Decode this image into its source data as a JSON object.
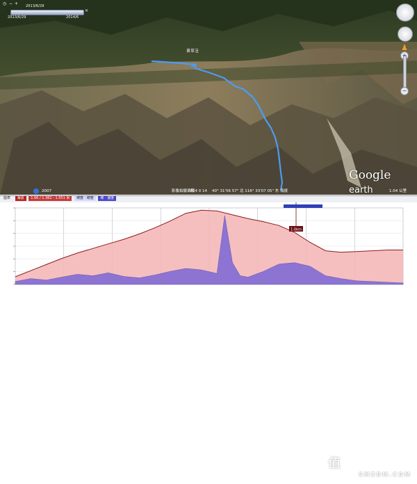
{
  "app": "Google Earth",
  "timeline": {
    "start_date": "2013/6/29",
    "end_date": "2014/6",
    "progress": 1.0
  },
  "map": {
    "place_label": "黄草洼",
    "logo_google": "Google",
    "logo_earth": "earth"
  },
  "statusbar": {
    "year": "2007",
    "imagery_date_label": "影像拍摄日期",
    "imagery_date": "2014 0 14",
    "coords": "40° 31'56 57\" 北 116° 33'07 05\" 东 海拔",
    "elev": "1.04 公里"
  },
  "profile": {
    "legend": [
      "图表",
      "海拔",
      "1.66 / 1.382 - 1.951 米",
      "坡度 · 坡度",
      "坡 · 速度"
    ],
    "marker_label": "1.0km",
    "watermark": "值",
    "watermark_site": "SMZDM.COM"
  },
  "chart_data": {
    "type": "area",
    "title": "",
    "xlabel": "",
    "ylabel": "",
    "series": [
      {
        "kind": "elevation",
        "x": [
          0,
          4,
          8,
          12,
          16,
          20,
          24,
          28,
          32,
          36,
          40,
          44,
          48,
          52,
          56,
          60,
          64,
          68,
          72,
          76,
          80,
          84,
          88,
          92,
          96,
          100
        ],
        "y": [
          0.1,
          0.18,
          0.26,
          0.34,
          0.41,
          0.47,
          0.53,
          0.59,
          0.66,
          0.74,
          0.83,
          0.93,
          0.97,
          0.96,
          0.91,
          0.86,
          0.82,
          0.77,
          0.68,
          0.55,
          0.44,
          0.42,
          0.43,
          0.44,
          0.45,
          0.45
        ]
      },
      {
        "kind": "slope",
        "x": [
          0,
          4,
          8,
          12,
          16,
          20,
          24,
          28,
          32,
          36,
          40,
          44,
          48,
          52,
          54,
          56,
          58,
          60,
          64,
          68,
          72,
          76,
          80,
          84,
          88,
          92,
          96,
          100
        ],
        "y": [
          0.04,
          0.08,
          0.06,
          0.1,
          0.14,
          0.12,
          0.16,
          0.11,
          0.09,
          0.13,
          0.18,
          0.22,
          0.2,
          0.15,
          0.95,
          0.3,
          0.12,
          0.1,
          0.18,
          0.28,
          0.3,
          0.25,
          0.12,
          0.08,
          0.05,
          0.04,
          0.03,
          0.02
        ]
      }
    ],
    "colors": {
      "elevation_line": "#8b1a1a",
      "elevation_fill": "#f4b4b4",
      "slope_fill": "#7b68d6",
      "grid": "#a8adb8"
    }
  }
}
